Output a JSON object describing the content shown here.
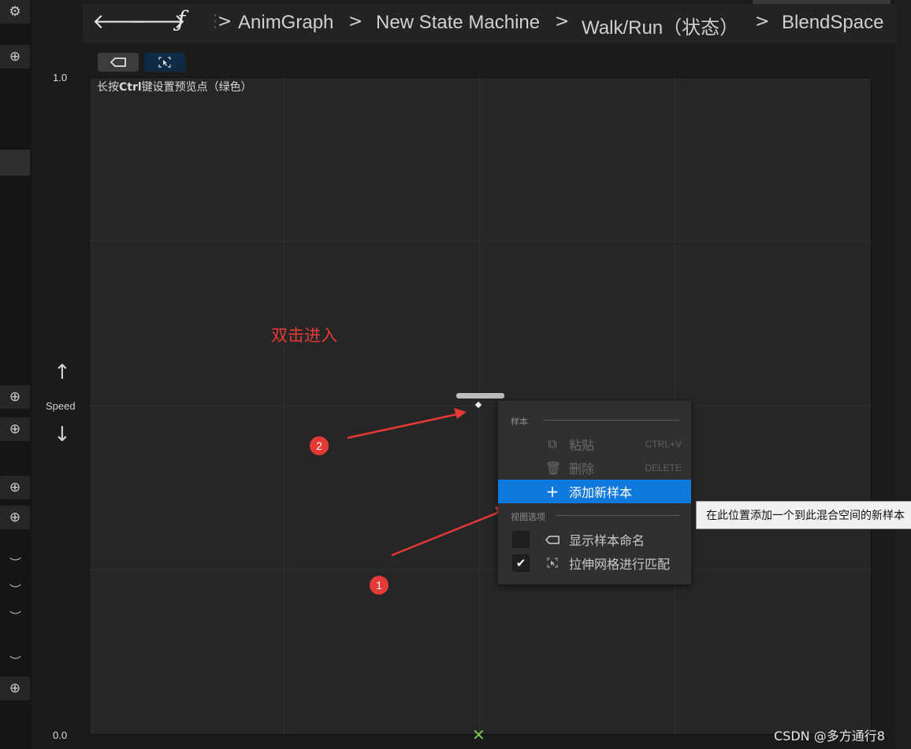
{
  "breadcrumb": {
    "items": [
      "AnimGraph",
      "New State Machine",
      "Walk/Run（状态）",
      "BlendSpace"
    ],
    "separator": ">"
  },
  "graph": {
    "hint_prefix": "长按",
    "hint_key": "Ctrl",
    "hint_suffix": "键设置预览点（绿色）",
    "y_max": "1.0",
    "y_min": "0.0",
    "y_axis_label": "Speed"
  },
  "annotation": {
    "text": "双击进入",
    "badge_1": "1",
    "badge_2": "2",
    "color": "#e53935"
  },
  "context_menu": {
    "section_samples": "样本",
    "paste_label": "粘贴",
    "paste_shortcut": "CTRL+V",
    "delete_label": "删除",
    "delete_shortcut": "DELETE",
    "add_sample_label": "添加新样本",
    "section_view": "视图选项",
    "show_names_label": "显示样本命名",
    "show_names_checked": false,
    "stretch_grid_label": "拉伸网格进行匹配",
    "stretch_grid_checked": true,
    "highlight_color": "#0e78dc"
  },
  "tooltip": {
    "text": "在此位置添加一个到此混合空间的新样本"
  },
  "watermark": "CSDN @多方通行8"
}
